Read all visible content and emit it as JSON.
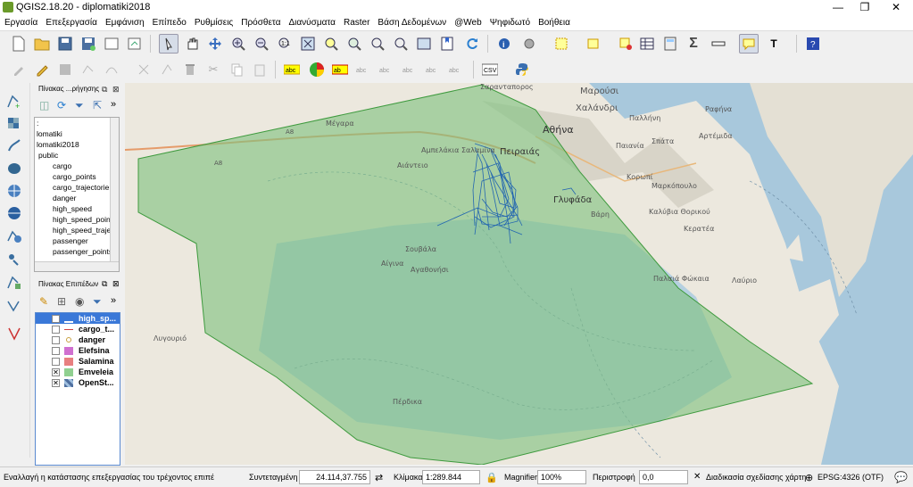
{
  "window": {
    "title": "QGIS2.18.20 - diplomatiki2018",
    "minimize": "—",
    "maximize": "❐",
    "close": "✕"
  },
  "menu": [
    "Εργασία",
    "Επεξεργασία",
    "Εμφάνιση",
    "Επίπεδο",
    "Ρυθμίσεις",
    "Πρόσθετα",
    "Διανύσματα",
    "Raster",
    "Βάση Δεδομένων",
    "@Web",
    "Ψηφιδωτό",
    "Βοήθεια"
  ],
  "browser_panel": {
    "title": "Πίνακας ...ρήγησης",
    "items": [
      ":",
      "lomatiki",
      "lomatiki2018",
      "public",
      "cargo",
      "cargo_points",
      "cargo_trajectorie",
      "danger",
      "high_speed",
      "high_speed_point",
      "high_speed_traje",
      "passenger",
      "passenger_points"
    ]
  },
  "layers_panel": {
    "title": "Πίνακας Επιπέδων",
    "layers": [
      {
        "name": "high_sp...",
        "checked": "✕",
        "color": "#2a6fc0"
      },
      {
        "name": "cargo_t...",
        "checked": "",
        "color": "#d04040"
      },
      {
        "name": "danger",
        "checked": "",
        "color": "#c8a040"
      },
      {
        "name": "Elefsina",
        "checked": "",
        "color": "#d070d0"
      },
      {
        "name": "Salamina",
        "checked": "",
        "color": "#e88080"
      },
      {
        "name": "Emveleia",
        "checked": "✕",
        "color": "#90d090"
      },
      {
        "name": "OpenSt...",
        "checked": "✕",
        "color": "#5070a0"
      }
    ]
  },
  "map_labels": [
    "Σαρανταπορος",
    "Μαρούσι",
    "Χαλάνδρι",
    "Παλλήνη",
    "Ραφήνα",
    "Μέγαρα",
    "Αθήνα",
    "Παιανία",
    "Σπάτα",
    "Αρτέμιδα",
    "Αμπελάκια Σαλαμίνα",
    "Πειραιάς",
    "Αιάντειο",
    "Κορωπί",
    "Μαρκόπουλο",
    "Γλυφάδα",
    "Βάρη",
    "Καλύβια Θορικού",
    "Κερατέα",
    "Σουβάλα",
    "Αίγινα",
    "Αγαθονήσι",
    "Παλαιά Φώκαια",
    "Λαύριο",
    "Λυγουριό",
    "Πέρδικα",
    "A8",
    "A8"
  ],
  "status": {
    "message": "Εναλλαγή η κατάστασης επεξεργασίας του τρέχοντος επιπέ",
    "coord_label": "Συντεταγμένη",
    "coord_value": "24.114,37.755",
    "scale_label": "Κλίμακα",
    "scale_value": "1:289.844",
    "magnifier_label": "Magnifier",
    "magnifier_value": "100%",
    "rotation_label": "Περιστροφή",
    "rotation_value": "0,0",
    "render_label": "Διαδικασία σχεδίασης χάρτη",
    "crs": "EPSG:4326 (OTF)"
  },
  "colors": {
    "polygon_fill": "#7fc27f",
    "polygon_stroke": "#3e9a3e",
    "trajectory": "#2366b0",
    "sea": "#a8c8dc",
    "land": "#e9e5dc"
  }
}
